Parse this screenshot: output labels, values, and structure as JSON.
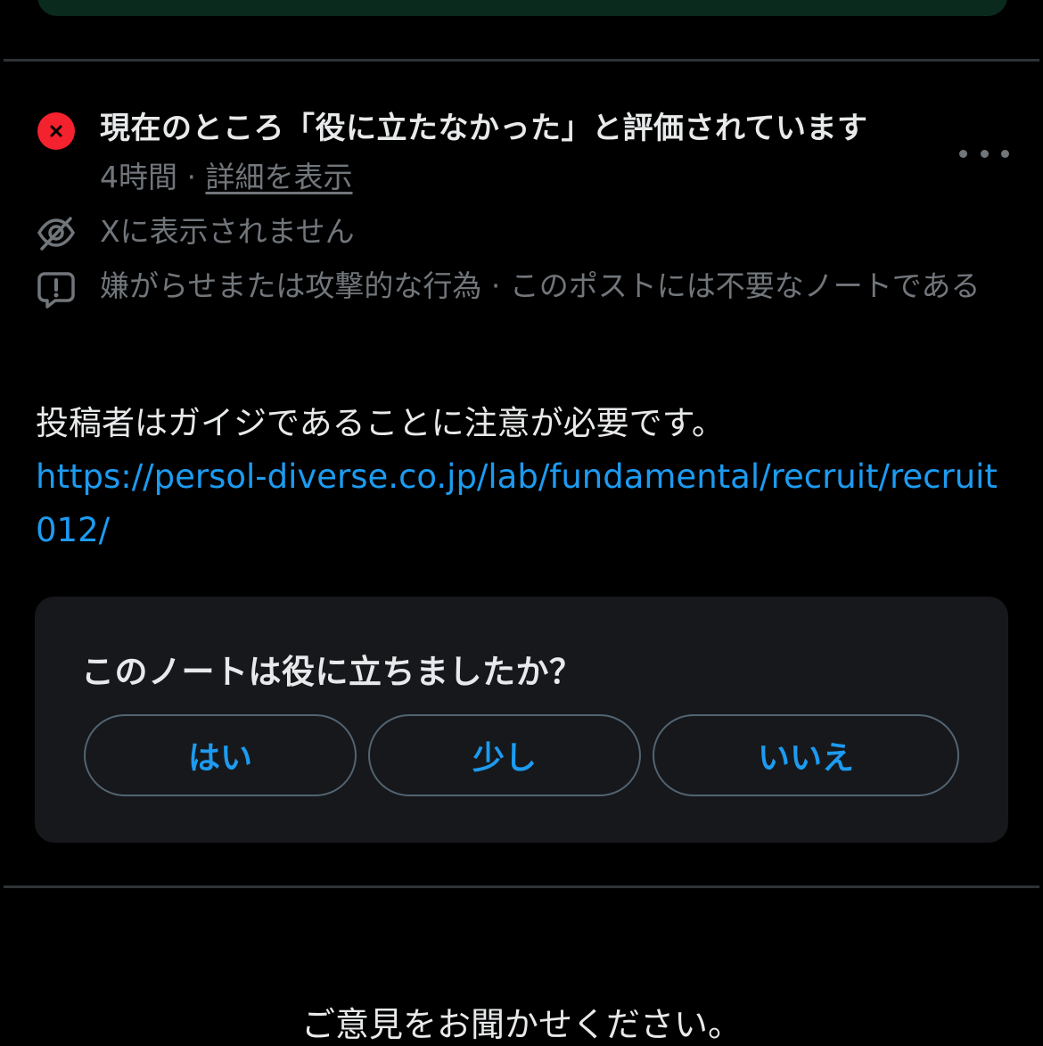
{
  "status": {
    "icon": "close-x-icon",
    "title": "現在のところ「役に立たなかった」と評価されています",
    "time": "4時間",
    "separator": "·",
    "details_link": "詳細を表示"
  },
  "visibility": {
    "icon": "eye-off-icon",
    "text": "Xに表示されません"
  },
  "reasons": {
    "icon": "report-bubble-icon",
    "text": "嫌がらせまたは攻撃的な行為 · このポストには不要なノートである"
  },
  "note": {
    "text": "投稿者はガイジであることに注意が必要です。",
    "url": "https://persol-diverse.co.jp/lab/fundamental/recruit/recruit012/"
  },
  "rating": {
    "question": "このノートは役に立ちましたか？",
    "yes": "はい",
    "somewhat": "少し",
    "no": "いいえ"
  },
  "feedback": {
    "text": "ご意見をお聞かせください。"
  },
  "colors": {
    "background": "#000000",
    "accent": "#1d9bf0",
    "danger": "#f4212e",
    "muted": "#71767b",
    "card": "#16181c"
  }
}
